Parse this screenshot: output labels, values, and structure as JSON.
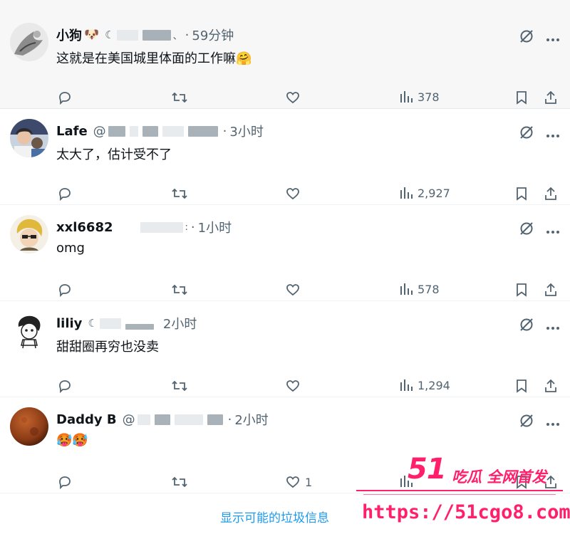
{
  "tweets": [
    {
      "name": "小狗",
      "name_emoji": "🐶",
      "handle_prefix": "@",
      "time": "59分钟",
      "text": "这就是在美国城里体面的工作嘛",
      "text_emoji": "🤗",
      "views": "378",
      "likes": ""
    },
    {
      "name": "Lafe",
      "name_emoji": "",
      "handle_prefix": "@",
      "time": "3小时",
      "text": "太大了，估计受不了",
      "text_emoji": "",
      "views": "2,927",
      "likes": ""
    },
    {
      "name": "xxl6682",
      "name_emoji": "",
      "handle_prefix": "",
      "time": "1小时",
      "text": "omg",
      "text_emoji": "",
      "views": "578",
      "likes": ""
    },
    {
      "name": "liliy",
      "name_emoji": "",
      "handle_prefix": "",
      "time": "2小时",
      "text": "甜甜圈再穷也没卖",
      "text_emoji": "",
      "views": "1,294",
      "likes": ""
    },
    {
      "name": "Daddy B",
      "name_emoji": "",
      "handle_prefix": "@",
      "time": "2小时",
      "text": "",
      "text_emoji": "🥵🥵",
      "views": "",
      "likes": "1"
    }
  ],
  "footer": {
    "spam_link": "显示可能的垃圾信息"
  },
  "watermark": {
    "brand": "51",
    "sub": "吃瓜 全网首发",
    "url": "https://51cgo8.com"
  },
  "colors": {
    "accent": "#1d9bf0",
    "muted": "#536471",
    "watermark": "#ff1f6b"
  },
  "icons": [
    "reply-icon",
    "retweet-icon",
    "like-icon",
    "views-icon",
    "bookmark-icon",
    "share-icon",
    "grok-icon",
    "more-icon"
  ]
}
